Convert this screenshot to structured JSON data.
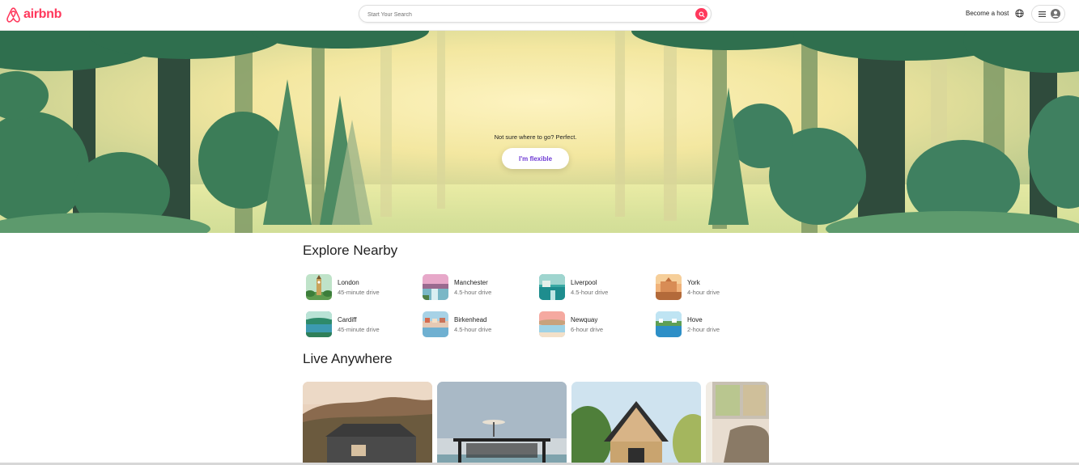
{
  "brand": {
    "name": "airbnb",
    "color": "#FF385C"
  },
  "search": {
    "placeholder": "Start Your Search",
    "icon": "search-icon"
  },
  "header": {
    "host_link": "Become a host",
    "globe_icon": "globe-icon",
    "menu_icon": "hamburger-menu-icon",
    "user_icon": "user-avatar-icon"
  },
  "hero": {
    "prompt": "Not sure where to go? Perfect.",
    "button_label": "I'm flexible",
    "button_color": "#6f3bd4"
  },
  "explore": {
    "title": "Explore Nearby",
    "items": [
      {
        "name": "London",
        "distance": "45-minute drive"
      },
      {
        "name": "Manchester",
        "distance": "4.5-hour drive"
      },
      {
        "name": "Liverpool",
        "distance": "4.5-hour drive"
      },
      {
        "name": "York",
        "distance": "4-hour drive"
      },
      {
        "name": "Cardiff",
        "distance": "45-minute drive"
      },
      {
        "name": "Birkenhead",
        "distance": "4.5-hour drive"
      },
      {
        "name": "Newquay",
        "distance": "6-hour drive"
      },
      {
        "name": "Hove",
        "distance": "2-hour drive"
      }
    ]
  },
  "live": {
    "title": "Live Anywhere"
  }
}
